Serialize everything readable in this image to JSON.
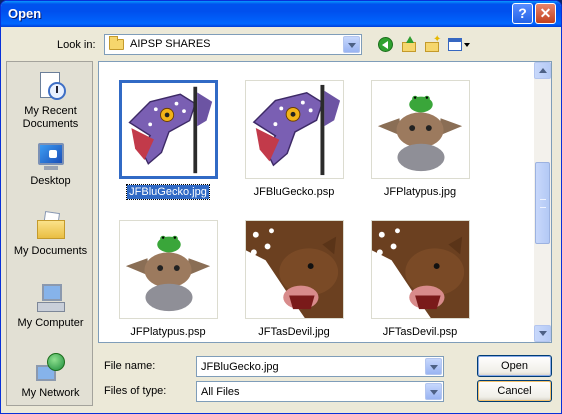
{
  "window": {
    "title": "Open",
    "help_glyph": "?",
    "close_glyph": "✕"
  },
  "lookin": {
    "label": "Look in:",
    "value": "AIPSP SHARES"
  },
  "places": [
    {
      "label": "My Recent Documents",
      "icon": "recent-documents-icon"
    },
    {
      "label": "Desktop",
      "icon": "desktop-icon"
    },
    {
      "label": "My Documents",
      "icon": "my-documents-icon"
    },
    {
      "label": "My Computer",
      "icon": "my-computer-icon"
    },
    {
      "label": "My Network",
      "icon": "my-network-icon"
    }
  ],
  "files": [
    {
      "name": "JFBluGecko.jpg",
      "thumb": "gecko",
      "selected": true
    },
    {
      "name": "JFBluGecko.psp",
      "thumb": "gecko",
      "selected": false
    },
    {
      "name": "JFPlatypus.jpg",
      "thumb": "platypus",
      "selected": false
    },
    {
      "name": "JFPlatypus.psp",
      "thumb": "platypus",
      "selected": false
    },
    {
      "name": "JFTasDevil.jpg",
      "thumb": "tasdevil",
      "selected": false
    },
    {
      "name": "JFTasDevil.psp",
      "thumb": "tasdevil",
      "selected": false
    }
  ],
  "filename": {
    "label": "File name:",
    "value": "JFBluGecko.jpg"
  },
  "filetype": {
    "label": "Files of type:",
    "value": "All Files"
  },
  "buttons": {
    "open": "Open",
    "cancel": "Cancel"
  },
  "colors": {
    "selection": "#316ac5",
    "titlebar": "#0053ee"
  }
}
